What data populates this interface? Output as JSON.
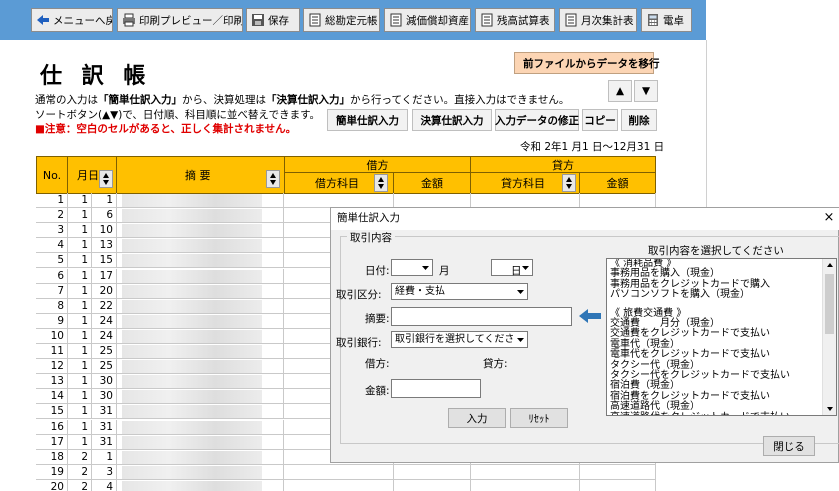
{
  "toolbar": {
    "menu_back": "メニューへ戻る",
    "print_preview": "印刷プレビュー／印刷",
    "save": "保存",
    "general_ledger": "総勘定元帳",
    "depreciation": "減価償却資産",
    "trial_balance": "残高試算表",
    "monthly_summary": "月次集計表",
    "calculator": "電卓"
  },
  "page": {
    "title": "仕 訳 帳",
    "import_button": "前ファイルからデータを移行",
    "info_line1_pre": "通常の入力は",
    "info_line1_b1": "「簡単仕訳入力」",
    "info_line1_mid": "から、決算処理は",
    "info_line1_b2": "「決算仕訳入力」",
    "info_line1_post": "から行ってください。直接入力はできません。",
    "info_line2": "ソートボタン(▲▼)で、日付順、科目順に並べ替えできます。",
    "warning": "■注意：空白のセルがあると、正しく集計されません。",
    "date_range": "令和 2年1 月1 日～12月31 日",
    "sort_up": "▲",
    "sort_down": "▼"
  },
  "actions": {
    "simple_entry": "簡単仕訳入力",
    "closing_entry": "決算仕訳入力",
    "edit_entry": "入力データの修正",
    "copy": "コピー",
    "delete": "削除"
  },
  "table": {
    "headers": {
      "no": "No.",
      "month_day": "月日",
      "description": "摘 要",
      "debit": "借方",
      "credit": "貸方",
      "debit_account": "借方科目",
      "debit_amount": "金額",
      "credit_account": "貸方科目",
      "credit_amount": "金額"
    },
    "rows": [
      {
        "no": "1",
        "month": "1",
        "day": "1"
      },
      {
        "no": "2",
        "month": "1",
        "day": "6"
      },
      {
        "no": "3",
        "month": "1",
        "day": "10"
      },
      {
        "no": "4",
        "month": "1",
        "day": "13"
      },
      {
        "no": "5",
        "month": "1",
        "day": "15"
      },
      {
        "no": "6",
        "month": "1",
        "day": "17"
      },
      {
        "no": "7",
        "month": "1",
        "day": "20"
      },
      {
        "no": "8",
        "month": "1",
        "day": "22"
      },
      {
        "no": "9",
        "month": "1",
        "day": "24"
      },
      {
        "no": "10",
        "month": "1",
        "day": "24"
      },
      {
        "no": "11",
        "month": "1",
        "day": "25"
      },
      {
        "no": "12",
        "month": "1",
        "day": "25"
      },
      {
        "no": "13",
        "month": "1",
        "day": "30"
      },
      {
        "no": "14",
        "month": "1",
        "day": "30"
      },
      {
        "no": "15",
        "month": "1",
        "day": "31"
      },
      {
        "no": "16",
        "month": "1",
        "day": "31"
      },
      {
        "no": "17",
        "month": "1",
        "day": "31"
      },
      {
        "no": "18",
        "month": "2",
        "day": "1"
      },
      {
        "no": "19",
        "month": "2",
        "day": "3"
      },
      {
        "no": "20",
        "month": "2",
        "day": "4"
      }
    ]
  },
  "dialog": {
    "title": "簡単仕訳入力",
    "close_x": "×",
    "group_label": "取引内容",
    "date_label": "日付:",
    "month_label": "月",
    "day_label": "日",
    "type_label": "取引区分:",
    "type_value": "経費・支払",
    "desc_label": "摘要:",
    "bank_label": "取引銀行:",
    "bank_value": "取引銀行を選択してください",
    "debit_label": "借方:",
    "credit_label": "貸方:",
    "amount_label": "金額:",
    "enter_button": "入力",
    "reset_button": "ﾘｾｯﾄ",
    "list_header": "取引内容を選択してください",
    "close_button": "閉じる",
    "list_items": [
      "《 消耗品費 》",
      "事務用品を購入（現金）",
      "事務用品をクレジットカードで購入",
      "パソコンソフトを購入（現金）",
      "",
      "《 旅費交通費 》",
      "交通費　　月分（現金）",
      "交通費をクレジットカードで支払い",
      "電車代（現金）",
      "電車代をクレジットカードで支払い",
      "タクシー代（現金）",
      "タクシー代をクレジットカードで支払い",
      "宿泊費（現金）",
      "宿泊費をクレジットカードで支払い",
      "高速道路代（現金）",
      "高速道路代をクレジットカードで支払い"
    ]
  },
  "colors": {
    "toolbar_bg": "#5b9bd5",
    "header_gold": "#ffc000",
    "warning_red": "#e00000",
    "import_button_bg": "#fcd5b4",
    "arrow_blue": "#2e75b6"
  }
}
